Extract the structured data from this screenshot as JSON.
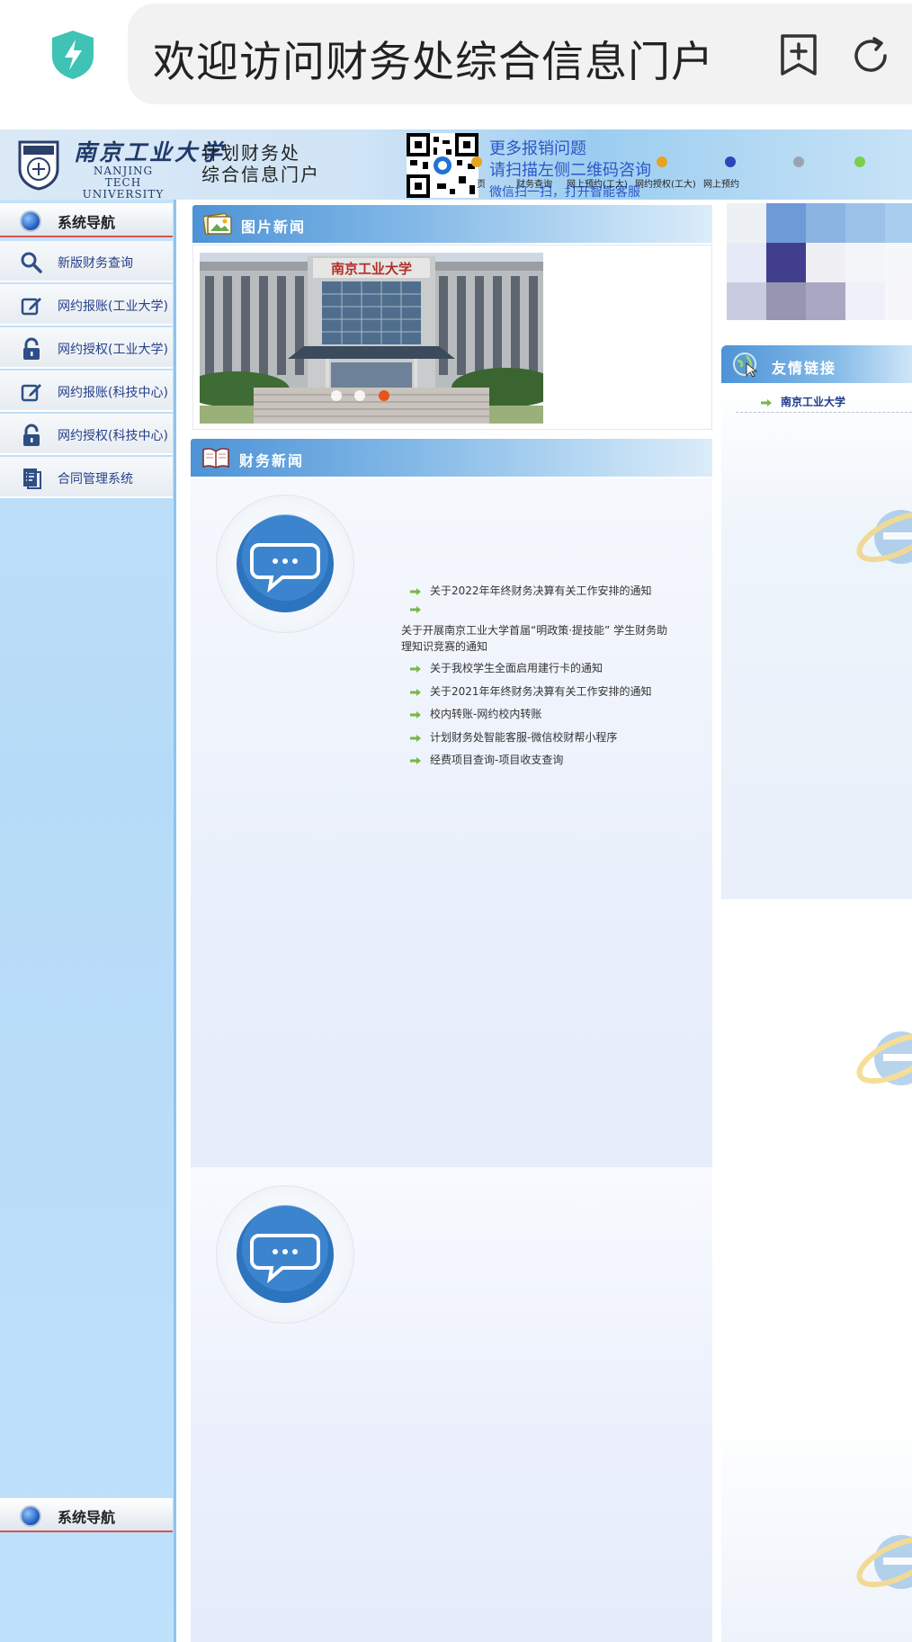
{
  "browser": {
    "address_text": "欢迎访问财务处综合信息门户"
  },
  "header": {
    "school_cn": "南京工业大学",
    "school_en": "NANJING TECH UNIVERSITY",
    "portal_line1": "计划财务处",
    "portal_line2": "综合信息门户",
    "qr_line1": "更多报销问题",
    "qr_line2": "请扫描左侧二维码咨询",
    "qr_line3": "微信扫一扫，打开智能客服",
    "top_links": [
      "页",
      "财务查询",
      "网上预约(工大)",
      "网约授权(工大)",
      "网上预约"
    ]
  },
  "sidebar": {
    "nav_title": "系统导航",
    "items": [
      {
        "label": "新版财务查询",
        "icon": "search-icon"
      },
      {
        "label": "网约报账(工业大学)",
        "icon": "edit-icon"
      },
      {
        "label": "网约授权(工业大学)",
        "icon": "lock-icon"
      },
      {
        "label": "网约报账(科技中心)",
        "icon": "edit-icon"
      },
      {
        "label": "网约授权(科技中心)",
        "icon": "lock-icon"
      },
      {
        "label": "合同管理系统",
        "icon": "document-icon"
      }
    ],
    "nav_title_bottom": "系统导航"
  },
  "photo_news": {
    "title": "图片新闻",
    "caption_sign": "南京工业大学",
    "active_slide": 3,
    "slide_count": 3
  },
  "finance_news": {
    "title": "财务新闻",
    "items": [
      {
        "text": "关于2022年年终财务决算有关工作安排的通知"
      },
      {
        "text": ""
      },
      {
        "text": "关于开展南京工业大学首届“明政策·提技能” 学生财务助"
      },
      {
        "text": "理知识竞赛的通知"
      },
      {
        "text": "关于我校学生全面启用建行卡的通知"
      },
      {
        "text": "关于2021年年终财务决算有关工作安排的通知"
      },
      {
        "text": "校内转账-网约校内转账"
      },
      {
        "text": "计划财务处智能客服-微信校财帮小程序"
      },
      {
        "text": "经费项目查询-项目收支查询"
      }
    ]
  },
  "friend_links": {
    "title": "友情链接",
    "items": [
      "南京工业大学"
    ]
  },
  "colors": {
    "accent_blue": "#4d93d6",
    "nav_text": "#27408b",
    "slide_active": "#e8541c",
    "arrow_green": "#7ab648"
  }
}
